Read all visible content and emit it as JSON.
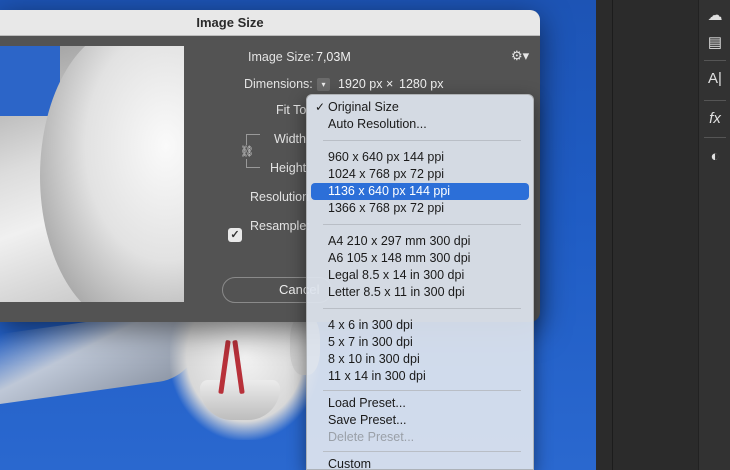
{
  "dialog": {
    "title": "Image Size",
    "image_size_label": "Image Size:",
    "image_size_value": "7,03M",
    "dimensions_label": "Dimensions:",
    "dimensions_width": "1920 px",
    "dimensions_times": "×",
    "dimensions_height": "1280 px",
    "fit_to_label": "Fit To",
    "width_label": "Width",
    "height_label": "Height",
    "resolution_label": "Resolution",
    "resample_label": "Resample:",
    "resample_checked": true,
    "cancel_label": "Cancel"
  },
  "fit_to_menu": {
    "checked_item": "Original Size",
    "items": [
      "Original Size",
      "Auto Resolution...",
      "960 x 640 px 144 ppi",
      "1024 x 768 px 72 ppi",
      "1136 x 640 px 144 ppi",
      "1366 x 768 px 72 ppi",
      "A4 210 x 297 mm 300 dpi",
      "A6 105 x 148 mm 300 dpi",
      "Legal 8.5 x 14 in 300 dpi",
      "Letter 8.5 x 11 in 300 dpi",
      "4 x 6 in 300 dpi",
      "5 x 7 in 300 dpi",
      "8 x 10 in 300 dpi",
      "11 x 14 in 300 dpi",
      "Load Preset...",
      "Save Preset...",
      "Delete Preset...",
      "Custom"
    ],
    "highlighted_item": "1136 x 640 px 144 ppi",
    "disabled_item": "Delete Preset..."
  },
  "tools": {
    "icons": [
      "creative-cloud-icon",
      "libraries-icon",
      "character-icon",
      "effects-icon",
      "adjustments-icon"
    ]
  },
  "colors": {
    "selection": "#2c6fd8",
    "dialog_bg": "#535353",
    "sky": "#1f5cc4"
  }
}
